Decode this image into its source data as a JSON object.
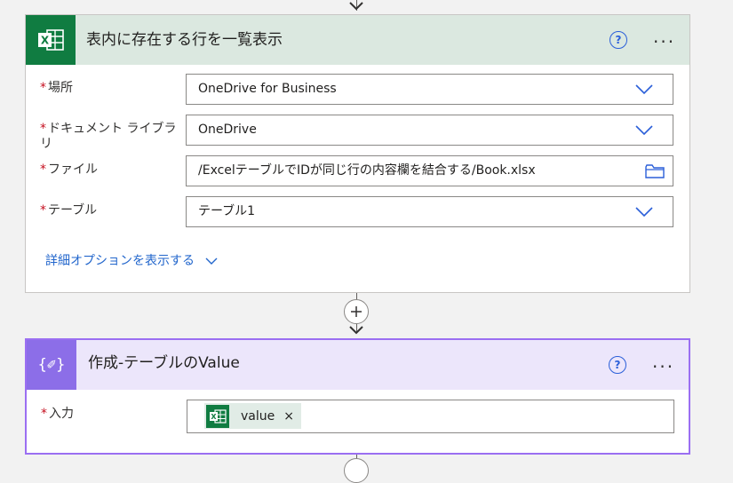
{
  "card1": {
    "title": "表内に存在する行を一覧表示",
    "help_label": "?",
    "more_label": "···",
    "fields": [
      {
        "required": "*",
        "label": "場所",
        "value": "OneDrive for Business",
        "control": "dropdown"
      },
      {
        "required": "*",
        "label": "ドキュメント ライブラリ",
        "value": "OneDrive",
        "control": "dropdown"
      },
      {
        "required": "*",
        "label": "ファイル",
        "value": "/ExcelテーブルでIDが同じ行の内容欄を結合する/Book.xlsx",
        "control": "file-picker"
      },
      {
        "required": "*",
        "label": "テーブル",
        "value": "テーブル1",
        "control": "dropdown"
      }
    ],
    "advanced_options": "詳細オプションを表示する"
  },
  "card2": {
    "title": "作成-テーブルのValue",
    "help_label": "?",
    "more_label": "···",
    "icon_text": "{✐}",
    "field": {
      "required": "*",
      "label": "入力",
      "token_label": "value",
      "token_remove": "×"
    }
  },
  "colors": {
    "excel_green": "#107c41",
    "compose_purple": "#8c6ee8",
    "link_blue": "#2266cc",
    "required_red": "#c50f1f"
  }
}
